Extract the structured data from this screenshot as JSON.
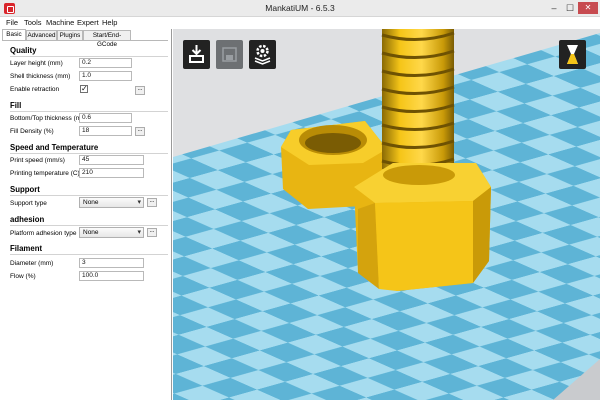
{
  "window": {
    "title": "MankatiUM - 6.5.3",
    "controls": [
      "minimize",
      "maximize",
      "close"
    ]
  },
  "menu": {
    "items": [
      "File",
      "Tools",
      "Machine",
      "Expert",
      "Help"
    ]
  },
  "tabs": [
    "Basic",
    "Advanced",
    "Plugins",
    "Start/End-GCode"
  ],
  "sections": {
    "quality": {
      "title": "Quality",
      "layer_height_label": "Layer height (mm)",
      "layer_height_value": "0.2",
      "shell_thickness_label": "Shell thickness (mm)",
      "shell_thickness_value": "1.0",
      "retraction_label": "Enable retraction",
      "retraction_checked": true,
      "retraction_mark": "✓"
    },
    "fill": {
      "title": "Fill",
      "bottom_top_label": "Bottom/Top thickness (mm)",
      "bottom_top_value": "0.6",
      "fill_density_label": "Fill Density (%)",
      "fill_density_value": "18"
    },
    "speed": {
      "title": "Speed and Temperature",
      "print_speed_label": "Print speed (mm/s)",
      "print_speed_value": "45",
      "printing_temp_label": "Printing temperature (C)",
      "printing_temp_value": "210"
    },
    "support": {
      "title": "Support",
      "support_type_label": "Support type",
      "support_type_value": "None"
    },
    "adhesion": {
      "title": "adhesion",
      "platform_label": "Platform adhesion type",
      "platform_value": "None"
    },
    "filament": {
      "title": "Filament",
      "diameter_label": "Diameter (mm)",
      "diameter_value": "3",
      "flow_label": "Flow (%)",
      "flow_value": "100.0"
    }
  },
  "buttons": {
    "dots": "..."
  },
  "viewport": {
    "toolbar_icons": [
      "load-model-icon",
      "save-toolpath-icon",
      "settings-icon"
    ],
    "view_icon": "view-mode-icon",
    "colors": {
      "floor_light": "#a6dcef",
      "floor_dark": "#5eb4d6",
      "model": "#f5c518",
      "model_shadow": "#c99a08",
      "background": "#dfe0e2"
    }
  }
}
